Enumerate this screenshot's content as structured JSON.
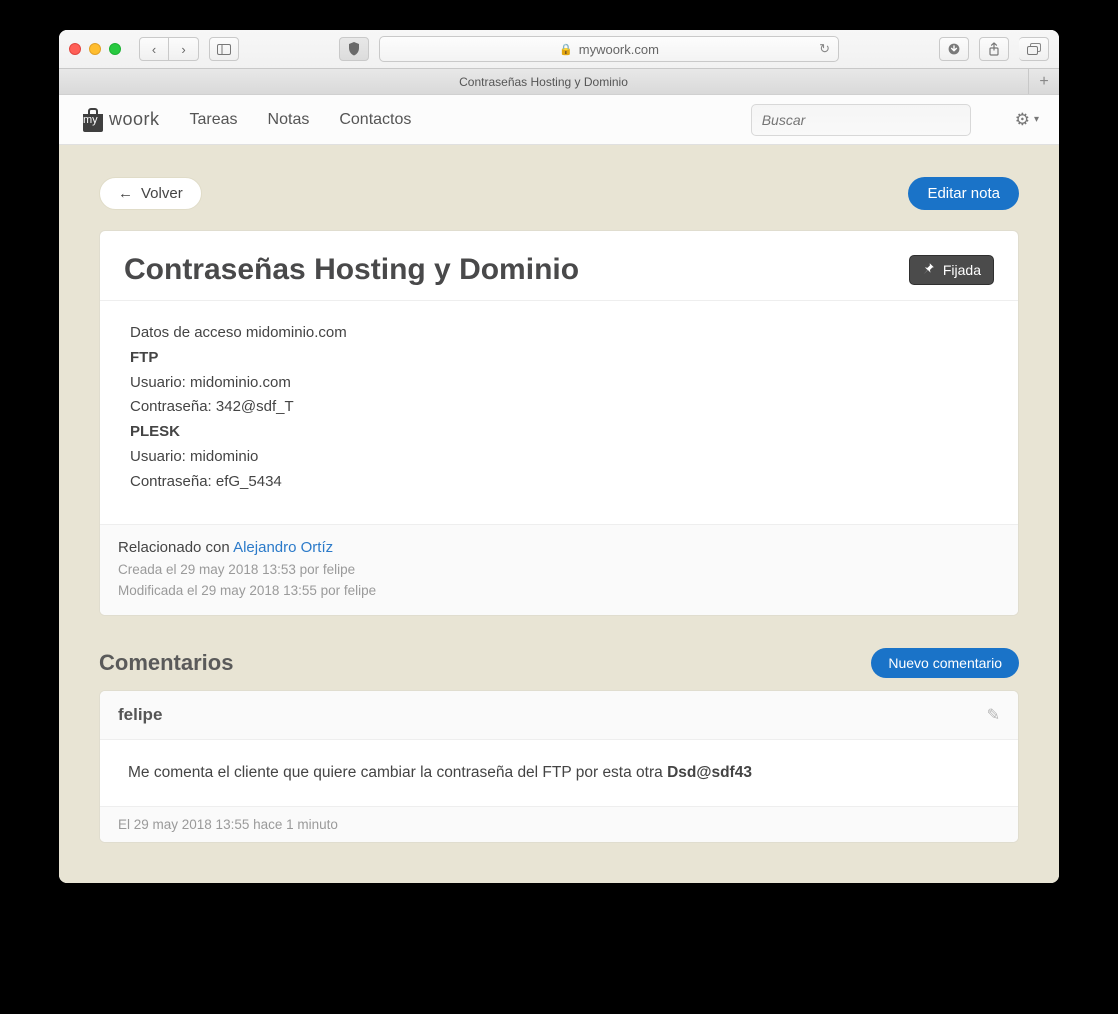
{
  "browser": {
    "domain": "mywoork.com",
    "tab_title": "Contraseñas Hosting y Dominio"
  },
  "nav": {
    "logo_my": "my",
    "logo_woork": "woork",
    "tareas": "Tareas",
    "notas": "Notas",
    "contactos": "Contactos",
    "search_placeholder": "Buscar"
  },
  "actions": {
    "back": "Volver",
    "edit_note": "Editar nota",
    "pinned": "Fijada",
    "new_comment": "Nuevo comentario"
  },
  "note": {
    "title": "Contraseñas Hosting y Dominio",
    "body": {
      "l1": "Datos de acceso midominio.com",
      "l2": "FTP",
      "l3": "Usuario: midominio.com",
      "l4": "Contraseña: 342@sdf_T",
      "l5": "PLESK",
      "l6": "Usuario: midominio",
      "l7": "Contraseña: efG_5434"
    },
    "related_label": "Relacionado con ",
    "related_name": "Alejandro Ortíz",
    "created": "Creada el 29 may 2018 13:53 por felipe",
    "modified": "Modificada el 29 may 2018 13:55 por felipe"
  },
  "comments": {
    "heading": "Comentarios",
    "items": [
      {
        "author": "felipe",
        "text_a": "Me comenta el cliente que quiere cambiar la contraseña del FTP por esta otra ",
        "text_b": "Dsd@sdf43",
        "timestamp": "El 29 may 2018 13:55 hace 1 minuto"
      }
    ]
  }
}
